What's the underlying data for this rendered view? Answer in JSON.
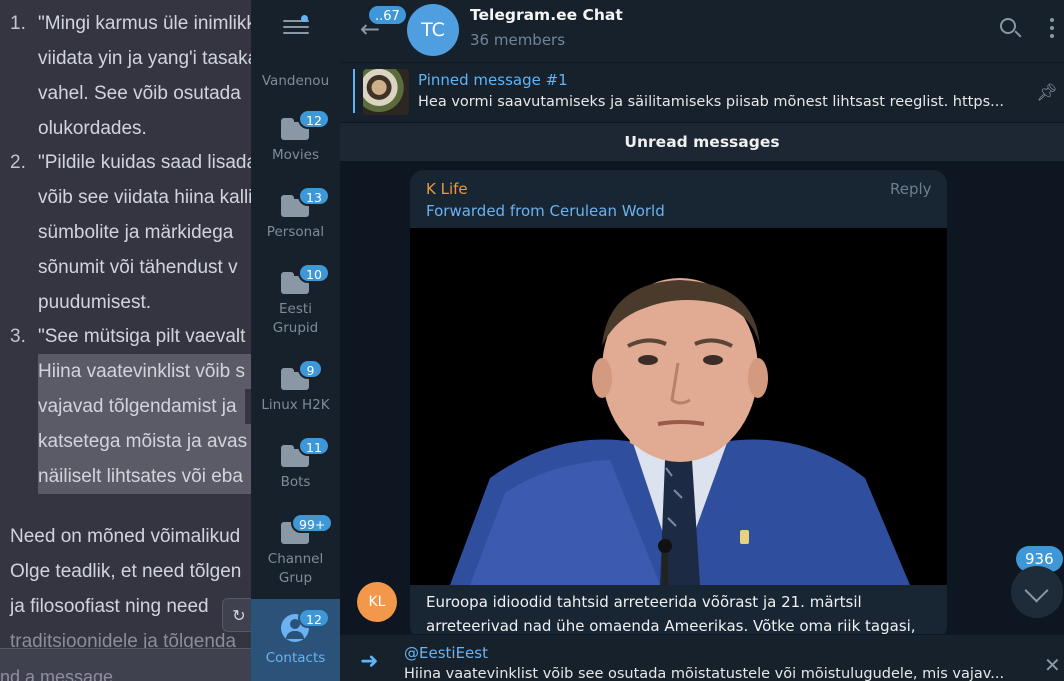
{
  "background_doc": {
    "items": [
      {
        "num": "1.",
        "lines": [
          "\"Mingi karmus üle inimlikkuse\" — see võib",
          "viidata yin ja yang'i tasakaalule ja",
          "vahel. See võib osutada",
          "olukordades."
        ]
      },
      {
        "num": "2.",
        "lines": [
          "\"Pildile kuidas saad lisada",
          "võib see viidata hiina kalli",
          "sümbolite ja märkidega",
          "sõnumit või tähendust v",
          "puudumisest."
        ]
      },
      {
        "num": "3.",
        "lines": [
          "\"See mütsiga pilt vaevalt"
        ]
      }
    ],
    "highlighted_lines": [
      "Hiina vaatevinklist võib s",
      "vajavad tõlgendamist ja",
      "katsetega mõista ja avas",
      "näiliselt lihtsates või eba"
    ],
    "paragraph_lines": [
      "Need on mõned võimalikud",
      "Olge teadlik, et need tõlgen",
      "ja filosoofiast ning need",
      "traditsioonidele ja tõlgenda"
    ],
    "input_placeholder": "nd a message..."
  },
  "sidebar": {
    "folders": [
      {
        "label": "Vandenou"
      },
      {
        "label": "Movies",
        "badge": "12"
      },
      {
        "label": "Personal",
        "badge": "13"
      },
      {
        "label": "Eesti Grupid",
        "badge": "10"
      },
      {
        "label": "Linux H2K",
        "badge": "9"
      },
      {
        "label": "Bots",
        "badge": "11"
      },
      {
        "label": "Channel Grup",
        "badge": "99+"
      }
    ],
    "contacts": {
      "label": "Contacts",
      "badge": "12"
    }
  },
  "header": {
    "back_badge": "..67",
    "avatar_initials": "TC",
    "title": "Telegram.ee Chat",
    "subtitle": "36 members"
  },
  "pinned": {
    "title": "Pinned message #1",
    "text": "Hea vormi saavutamiseks ja säilitamiseks piisab mõnest lihtsast reeglist. https..."
  },
  "unread_label": "Unread messages",
  "message": {
    "author": "K Life",
    "reply_label": "Reply",
    "forwarded": "Forwarded from Cerulean World",
    "text": "Euroopa idioodid tahtsid arreteerida võõrast ja 21. märtsil arreteerivad nad ühe omaenda Ameerikas. Võtke oma riik tagasi,",
    "sender_initials": "KL"
  },
  "scroll": {
    "unread_count": "936"
  },
  "reply_panel": {
    "title": "@EestiEest",
    "text": "Hiina vaatevinklist võib see osutada mõistatustele või mõistulugudele, mis vajav..."
  },
  "colors": {
    "accent": "#5eb5f7",
    "badge": "#3e97d7",
    "author": "#e99a3f",
    "chat_bg": "#0e1621",
    "panel_bg": "#17212b"
  }
}
